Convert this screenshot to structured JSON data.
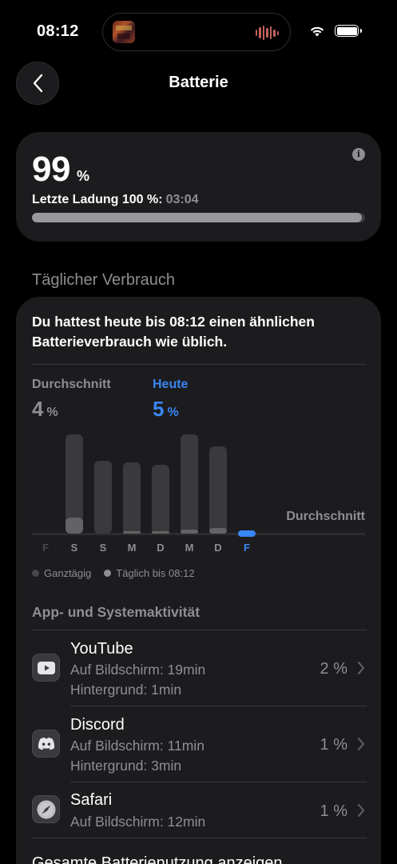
{
  "status": {
    "time": "08:12"
  },
  "nav": {
    "title": "Batterie"
  },
  "level": {
    "value": "99",
    "unit": "%",
    "last_charge_label": "Letzte Ladung 100 %:",
    "last_charge_time": "03:04",
    "fill_percent": 99
  },
  "section": {
    "daily_usage": "Täglicher Verbrauch"
  },
  "usage": {
    "summary": "Du hattest heute bis 08:12 einen ähnlichen Batterieverbrauch wie üblich.",
    "average": {
      "label": "Durchschnitt",
      "value": "4",
      "unit": "%"
    },
    "today": {
      "label": "Heute",
      "value": "5",
      "unit": "%"
    },
    "average_line_label": "Durchschnitt"
  },
  "chart_data": {
    "type": "bar",
    "categories": [
      "F",
      "S",
      "S",
      "M",
      "D",
      "M",
      "D",
      "F"
    ],
    "series": [
      {
        "name": "Ganztägig",
        "values": [
          0,
          100,
          73,
          72,
          69,
          100,
          88,
          0
        ]
      },
      {
        "name": "Täglich bis 08:12",
        "values": [
          0,
          16,
          0,
          2,
          1,
          4,
          6,
          5
        ]
      }
    ],
    "highlight_index": 7,
    "legend": [
      "Ganztägig",
      "Täglich bis 08:12"
    ],
    "colors": {
      "total": "#3a3a3c",
      "partial": "#636366",
      "today": "#3a86f4"
    }
  },
  "apps": {
    "header": "App- und Systemaktivität",
    "items": [
      {
        "name": "YouTube",
        "screen": "Auf Bildschirm: 19min",
        "background": "Hintergrund: 1min",
        "percent": "2 %",
        "icon": "youtube-icon"
      },
      {
        "name": "Discord",
        "screen": "Auf Bildschirm: 11min",
        "background": "Hintergrund: 3min",
        "percent": "1 %",
        "icon": "discord-icon"
      },
      {
        "name": "Safari",
        "screen": "Auf Bildschirm: 12min",
        "background": "",
        "percent": "1 %",
        "icon": "safari-icon"
      }
    ],
    "show_all": "Gesamte Batterienutzung anzeigen"
  }
}
